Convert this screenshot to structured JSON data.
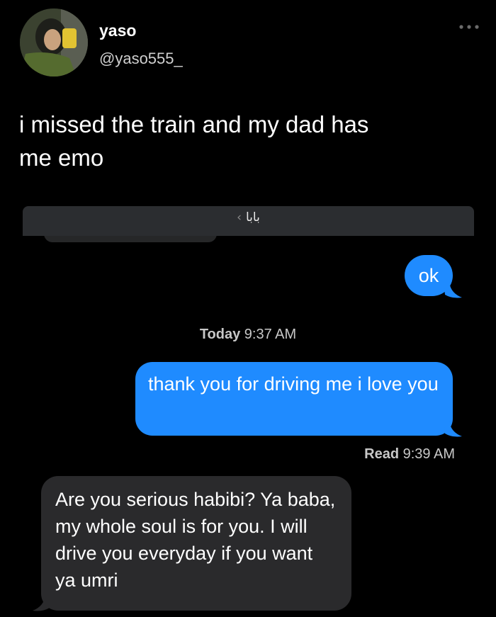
{
  "tweet": {
    "display_name": "yaso",
    "handle": "@yaso555_",
    "text": "i missed the train and my dad has\nme emo"
  },
  "screenshot": {
    "contact_name": "بابا",
    "timestamp_day": "Today",
    "timestamp_time": "9:37 AM",
    "read_label": "Read",
    "read_time": "9:39 AM",
    "messages": [
      {
        "direction": "outgoing",
        "text": "ok"
      },
      {
        "direction": "outgoing",
        "text": "thank you for driving me i love you"
      },
      {
        "direction": "incoming",
        "text": "Are you serious habibi? Ya baba, my  whole soul is for you. I will drive you everyday if you want ya umri"
      }
    ]
  },
  "colors": {
    "background": "#000000",
    "outgoing_bubble": "#1f8bff",
    "incoming_bubble": "#2a2a2c"
  },
  "icons": {
    "more": "more-icon",
    "chevron": "chevron-left-icon"
  }
}
